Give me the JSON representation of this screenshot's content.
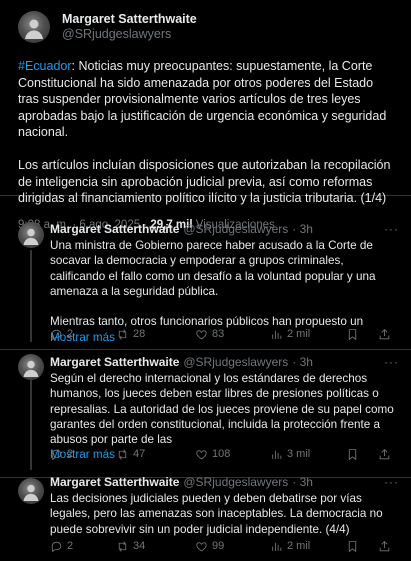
{
  "main_tweet": {
    "author_name": "Margaret Satterthwaite",
    "author_handle": "@SRjudgeslawyers",
    "hashtag": "#Ecuador",
    "text_after_hashtag": ": Noticias muy preocupantes: supuestamente, la Corte Constitucional ha sido amenazada por otros poderes del Estado tras suspender provisionalmente varios artículos de tres leyes aprobadas bajo la justificación de urgencia económica y seguridad nacional.\n\nLos artículos incluían disposiciones que autorizaban la recopilación de inteligencia sin aprobación judicial previa, así como reformas dirigidas al financiamiento político ilícito y la justicia tributaria. (1/4)",
    "timestamp": "9:08 a. m. · 6 ago. 2025 · ",
    "views_count": "29,7 mil",
    "views_label": " Visualizaciones"
  },
  "replies": [
    {
      "author_name": "Margaret Satterthwaite",
      "author_handle": "@SRjudgeslawyers",
      "time": "· 3h",
      "text": "Una ministra de Gobierno parece haber acusado a la Corte de socavar la democracia y empoderar a grupos criminales, calificando el fallo como un desafío a la voluntad popular y una amenaza a la seguridad pública.\n\nMientras tanto, otros funcionarios públicos han propuesto un",
      "show_more": "Mostrar más",
      "replies": "2",
      "reposts": "28",
      "likes": "83",
      "views": "2 mil"
    },
    {
      "author_name": "Margaret Satterthwaite",
      "author_handle": "@SRjudgeslawyers",
      "time": "· 3h",
      "text": "Según el derecho internacional y los estándares de derechos humanos, los jueces deben estar libres de presiones políticas o represalias. La autoridad de los jueces proviene de su papel como garantes del orden constitucional, incluida la protección frente a abusos por parte de las",
      "show_more": "Mostrar más",
      "replies": "2",
      "reposts": "47",
      "likes": "108",
      "views": "3 mil"
    },
    {
      "author_name": "Margaret Satterthwaite",
      "author_handle": "@SRjudgeslawyers",
      "time": "· 3h",
      "text": "Las decisiones judiciales pueden y deben debatirse por vías legales, pero las amenazas son inaceptables. La democracia no puede sobrevivir sin un poder judicial independiente. (4/4)",
      "show_more": "",
      "replies": "2",
      "reposts": "34",
      "likes": "99",
      "views": "2 mil"
    }
  ],
  "icons": {
    "more": "more-icon",
    "reply": "reply-icon",
    "repost": "repost-icon",
    "like": "like-icon",
    "views": "views-icon",
    "bookmark": "bookmark-icon",
    "share": "share-icon"
  },
  "colors": {
    "background": "#000000",
    "text": "#e7e9ea",
    "muted": "#71767b",
    "accent": "#1d9bf0",
    "border": "#2f3336"
  }
}
